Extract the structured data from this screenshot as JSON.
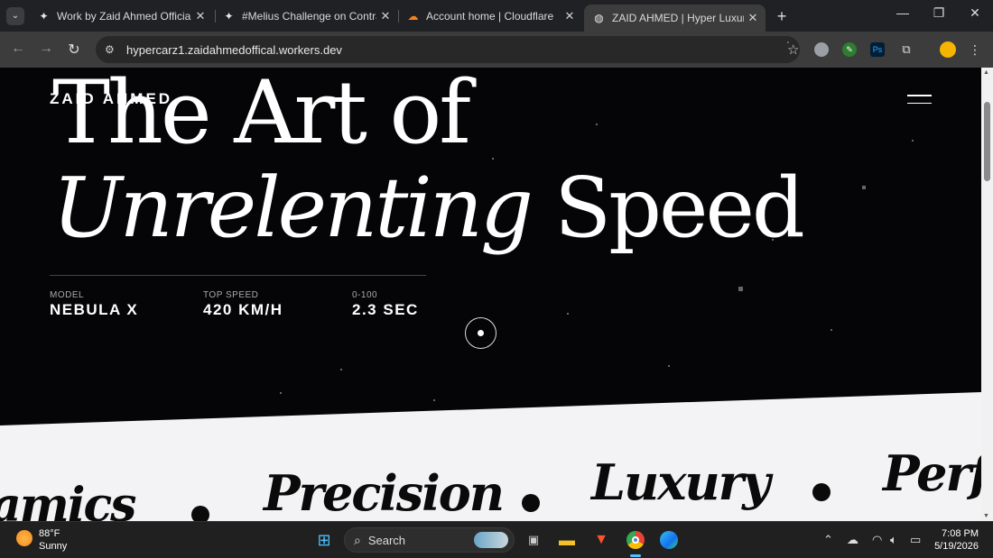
{
  "browser": {
    "tabs": [
      {
        "title": "Work by Zaid Ahmed Official",
        "icon": "diamond-star-icon"
      },
      {
        "title": "#Melius Challenge on Contra",
        "icon": "diamond-star-icon"
      },
      {
        "title": "Account home | Cloudflare",
        "icon": "cloudflare-icon"
      },
      {
        "title": "ZAID AHMED | Hyper Luxury Au",
        "icon": "globe-icon",
        "active": true
      }
    ],
    "url": "hypercarz1.zaidahmedoffical.workers.dev"
  },
  "page": {
    "logo": "ZAID AHMED",
    "hero": {
      "line1": "The Art of",
      "line2_italic": "Unrelenting",
      "line2_rest": "Speed"
    },
    "specs": [
      {
        "label": "MODEL",
        "value": "NEBULA X"
      },
      {
        "label": "TOP SPEED",
        "value": "420 KM/H"
      },
      {
        "label": "0-100",
        "value": "2.3 SEC"
      }
    ],
    "marquee": [
      "amics",
      "Precision",
      "Luxury",
      "Perf"
    ]
  },
  "taskbar": {
    "weather_temp": "88°F",
    "weather_desc": "Sunny",
    "search_label": "Search",
    "time": "7:08 PM",
    "date": "5/19/2026"
  }
}
